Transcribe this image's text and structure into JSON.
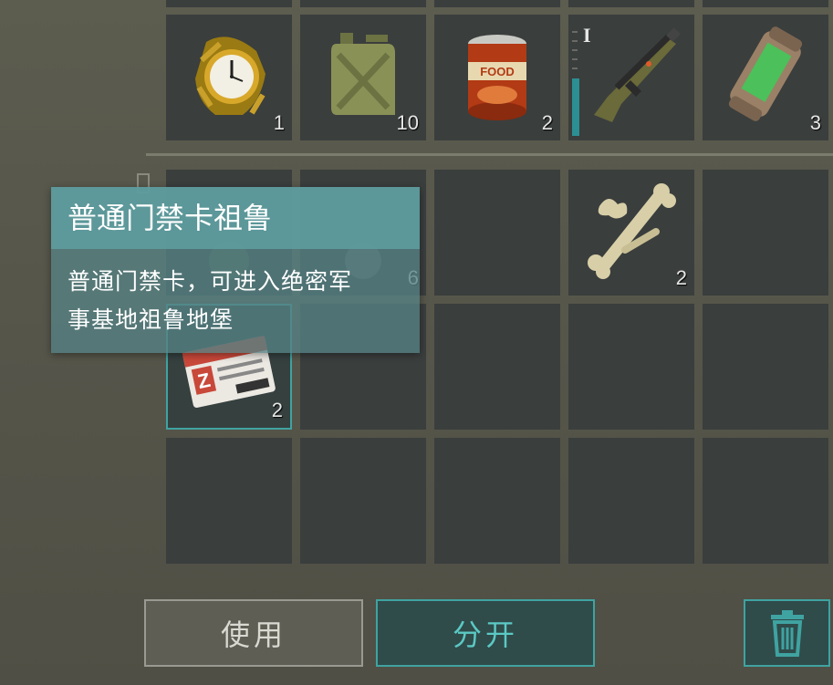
{
  "inventory": {
    "row1": [
      {
        "name": "wristwatch",
        "count": "1"
      },
      {
        "name": "jerry-can",
        "count": "10"
      },
      {
        "name": "canned-food",
        "count": "2",
        "label": "FOOD"
      },
      {
        "name": "rifle",
        "count": "",
        "tier": "I",
        "durability": 0.55
      },
      {
        "name": "energy-canister",
        "count": "3"
      }
    ],
    "row2": [
      {
        "name": "hidden-item-a",
        "count": ""
      },
      {
        "name": "hidden-item-b",
        "count": "6"
      },
      {
        "name": "empty",
        "count": ""
      },
      {
        "name": "bones",
        "count": "2"
      },
      {
        "name": "empty",
        "count": ""
      }
    ],
    "row3": [
      {
        "name": "access-card",
        "count": "2",
        "card_text": "Z"
      }
    ]
  },
  "tooltip": {
    "title": "普通门禁卡祖鲁",
    "description_line1": "普通门禁卡，可进入绝密军",
    "description_line2": "事基地祖鲁地堡"
  },
  "buttons": {
    "use": "使用",
    "split": "分开",
    "trash_icon": "trash-icon"
  },
  "colors": {
    "accent": "#3fa3a1",
    "slot": "#3a3e3d",
    "background": "#57574a"
  }
}
